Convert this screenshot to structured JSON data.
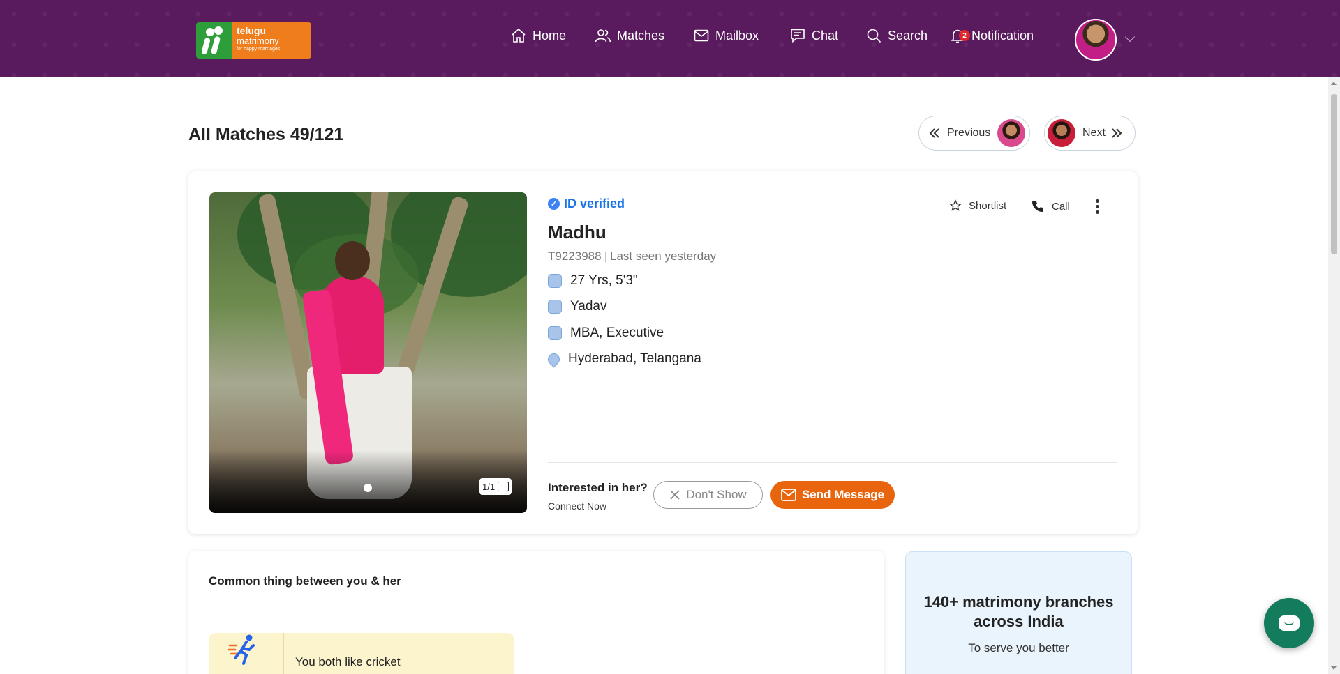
{
  "header": {
    "logo": {
      "line1": "telugu",
      "line2": "matrimony",
      "tagline": "for happy marriages"
    },
    "nav": [
      {
        "label": "Home",
        "icon": "home-icon"
      },
      {
        "label": "Matches",
        "icon": "users-icon"
      },
      {
        "label": "Mailbox",
        "icon": "mail-icon"
      },
      {
        "label": "Chat",
        "icon": "chat-icon"
      },
      {
        "label": "Search",
        "icon": "search-icon"
      },
      {
        "label": "Notification",
        "icon": "bell-icon",
        "badge": "2"
      }
    ]
  },
  "page": {
    "title": "All Matches 49/121",
    "previous_label": "Previous",
    "next_label": "Next"
  },
  "profile": {
    "verified_label": "ID verified",
    "name": "Madhu",
    "id": "T9223988",
    "last_seen": "Last seen yesterday",
    "attributes": [
      {
        "icon": "age-height-icon",
        "text": "27 Yrs, 5'3\""
      },
      {
        "icon": "caste-icon",
        "text": "Yadav"
      },
      {
        "icon": "profession-icon",
        "text": "MBA, Executive"
      },
      {
        "icon": "location-icon",
        "text": "Hyderabad, Telangana"
      }
    ],
    "shortlist_label": "Shortlist",
    "call_label": "Call",
    "photo_counter": "1/1",
    "interest_question": "Interested in her?",
    "connect_label": "Connect Now",
    "dont_show_label": "Don't Show",
    "send_message_label": "Send Message"
  },
  "common": {
    "title": "Common thing between you & her",
    "items": [
      {
        "icon": "running-person-icon",
        "text": "You both like cricket"
      }
    ]
  },
  "branches": {
    "title": "140+ matrimony branches across India",
    "subtitle": "To serve you better"
  },
  "colors": {
    "header_bg": "#5a1a5e",
    "accent_orange": "#e8650d",
    "verified_blue": "#1a73e8",
    "chat_fab": "#127c5c"
  }
}
